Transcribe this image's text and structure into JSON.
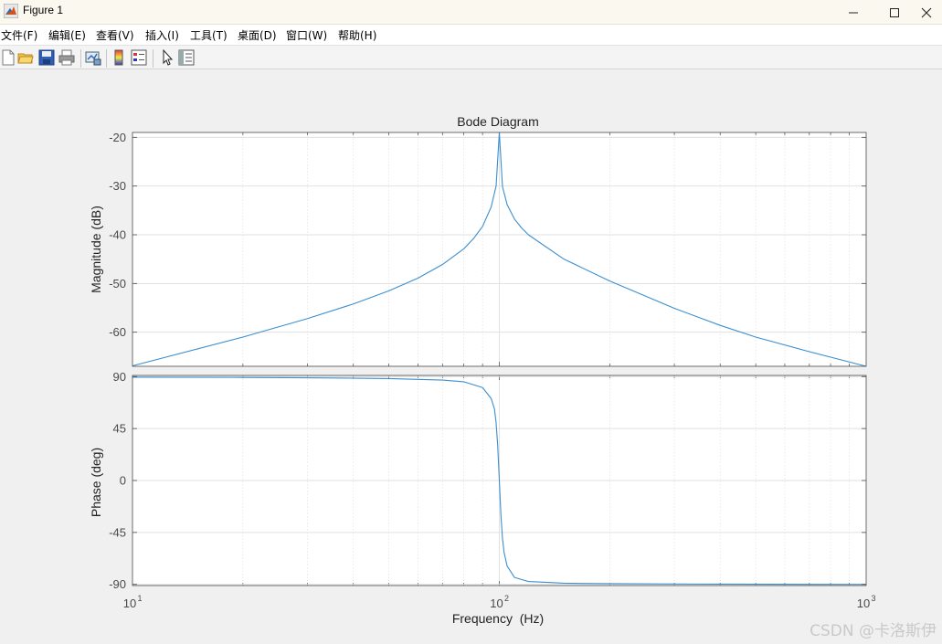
{
  "window": {
    "title": "Figure 1",
    "minimize_glyph": "—",
    "maximize_glyph": "☐",
    "close_glyph": "✕"
  },
  "menu": {
    "items": [
      "文件(F)",
      "编辑(E)",
      "查看(V)",
      "插入(I)",
      "工具(T)",
      "桌面(D)",
      "窗口(W)",
      "帮助(H)"
    ]
  },
  "toolbar": {
    "icons": [
      "new-figure-icon",
      "open-file-icon",
      "save-icon",
      "print-icon",
      "link-plot-icon",
      "insert-colorbar-icon",
      "insert-legend-icon",
      "edit-plot-pointer-icon",
      "property-inspector-icon"
    ]
  },
  "colors": {
    "line": "#3b8fd1",
    "grid": "#e1e1e1",
    "axes_bg": "#ffffff",
    "axis": "#4a4a4a"
  },
  "chart_data": [
    {
      "type": "line",
      "title": "Bode Diagram",
      "ylabel": "Magnitude (dB)",
      "xscale": "log",
      "xlim": [
        10,
        1000
      ],
      "ylim": [
        -67,
        -19
      ],
      "yticks": [
        -20,
        -30,
        -40,
        -50,
        -60
      ],
      "series": [
        {
          "x": [
            10,
            20,
            30,
            40,
            50,
            60,
            70,
            80,
            85,
            90,
            95,
            98,
            100,
            102,
            105,
            110,
            115,
            120,
            150,
            200,
            300,
            400,
            500,
            700,
            1000
          ],
          "values": [
            -66.9,
            -61,
            -57.2,
            -54.2,
            -51.5,
            -48.9,
            -46.1,
            -42.9,
            -40.8,
            -38.3,
            -34.3,
            -30,
            -19,
            -30.1,
            -33.8,
            -36.8,
            -38.6,
            -40.0,
            -45.0,
            -49.5,
            -55.1,
            -58.6,
            -61.0,
            -64.0,
            -67.0
          ]
        }
      ]
    },
    {
      "type": "line",
      "ylabel": "Phase (deg)",
      "xlabel": "Frequency  (Hz)",
      "xscale": "log",
      "xlim": [
        10,
        1000
      ],
      "ylim": [
        -91,
        91
      ],
      "yticks": [
        90,
        45,
        0,
        -45,
        -90
      ],
      "xtick_labels": [
        {
          "base": "10",
          "exp": "1"
        },
        {
          "base": "10",
          "exp": "2"
        },
        {
          "base": "10",
          "exp": "3"
        }
      ],
      "series": [
        {
          "x": [
            10,
            20,
            30,
            50,
            70,
            80,
            90,
            95,
            97,
            98,
            99,
            99.5,
            100,
            100.5,
            101,
            102,
            103,
            105,
            110,
            120,
            150,
            200,
            400,
            1000
          ],
          "values": [
            89.5,
            89.3,
            89,
            88.3,
            87,
            85.5,
            80.5,
            71,
            62,
            50,
            30,
            15,
            0,
            -15,
            -30,
            -50,
            -62,
            -74,
            -84,
            -87.5,
            -89,
            -89.4,
            -89.8,
            -90
          ]
        }
      ]
    }
  ],
  "watermark": "CSDN @卡洛斯伊"
}
